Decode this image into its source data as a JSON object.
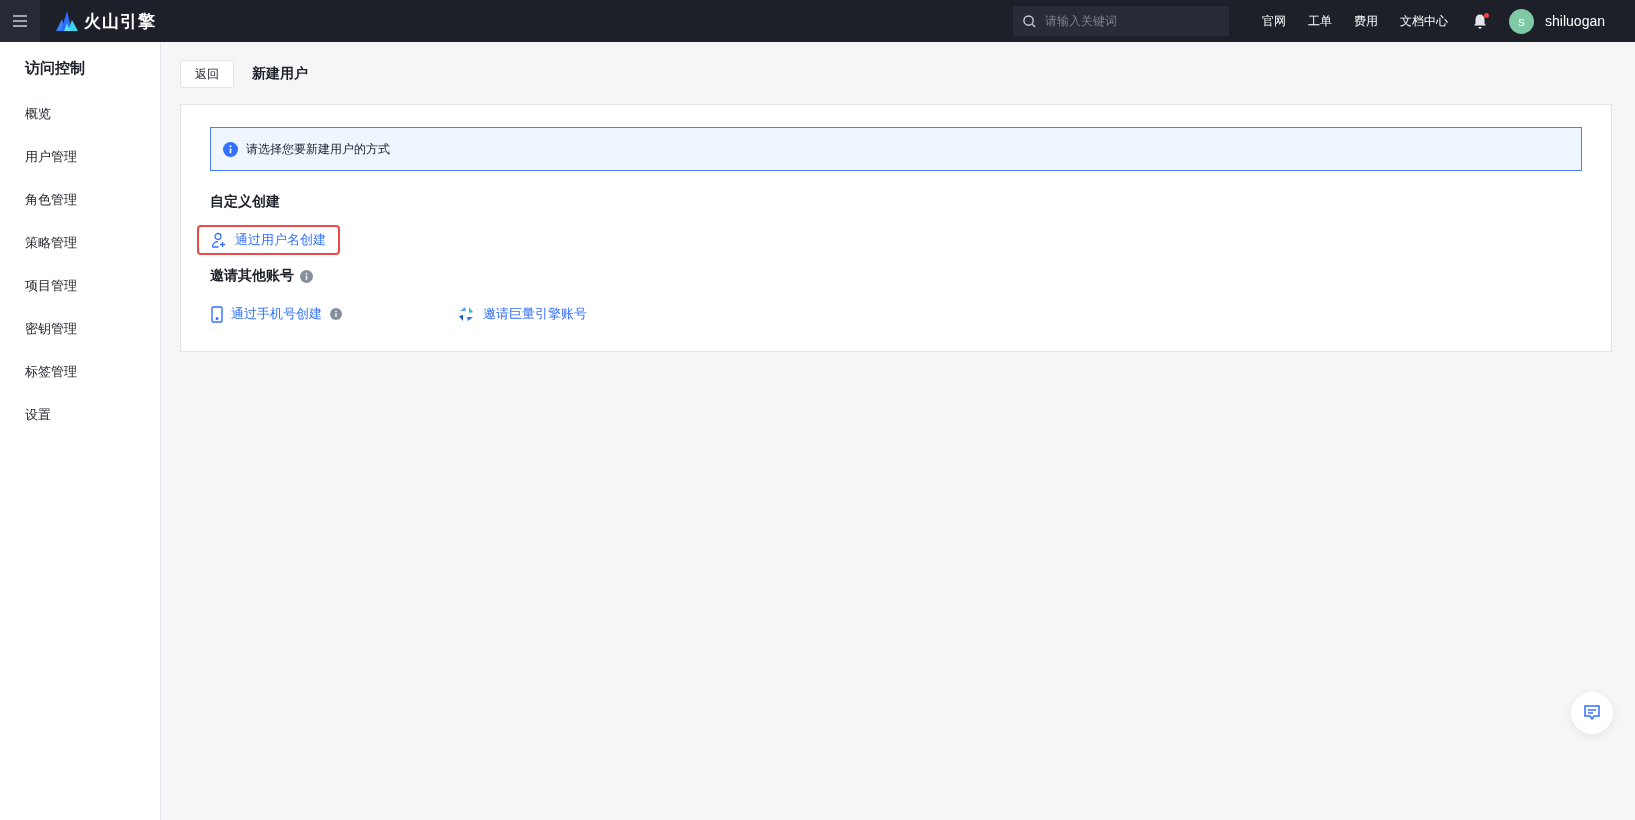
{
  "header": {
    "logo_text": "火山引擎",
    "search": {
      "placeholder": "请输入关键词"
    },
    "links": [
      "官网",
      "工单",
      "费用",
      "文档中心"
    ],
    "notification_dot": true,
    "user": {
      "initial": "s",
      "name": "shiluogan"
    }
  },
  "sidebar": {
    "title": "访问控制",
    "items": [
      {
        "label": "概览",
        "selected": false
      },
      {
        "label": "用户管理",
        "selected": false
      },
      {
        "label": "角色管理",
        "selected": false
      },
      {
        "label": "策略管理",
        "selected": false
      },
      {
        "label": "项目管理",
        "selected": false
      },
      {
        "label": "密钥管理",
        "selected": false
      },
      {
        "label": "标签管理",
        "selected": false
      },
      {
        "label": "设置",
        "selected": false
      }
    ]
  },
  "page": {
    "back_button": "返回",
    "title": "新建用户",
    "notice": "请选择您要新建用户的方式",
    "sections": [
      {
        "title": "自定义创建",
        "info": false,
        "options": [
          {
            "kind": "user",
            "label": "通过用户名创建",
            "info": false,
            "highlighted": true
          }
        ]
      },
      {
        "title": "邀请其他账号",
        "info": true,
        "options": [
          {
            "kind": "phone",
            "label": "通过手机号创建",
            "info": true,
            "highlighted": false
          },
          {
            "kind": "brand",
            "label": "邀请巨量引擎账号",
            "info": false,
            "highlighted": false
          }
        ]
      }
    ]
  }
}
